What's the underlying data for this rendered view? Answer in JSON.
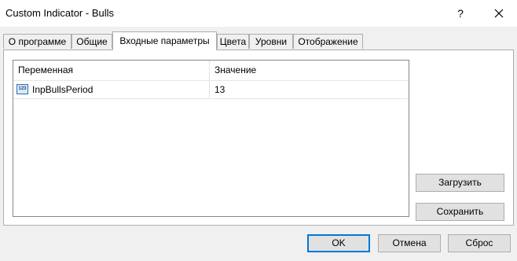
{
  "window": {
    "title": "Custom Indicator - Bulls",
    "help_label": "?",
    "close_label": "×"
  },
  "tabs": [
    {
      "label": "О программе"
    },
    {
      "label": "Общие"
    },
    {
      "label": "Входные параметры"
    },
    {
      "label": "Цвета"
    },
    {
      "label": "Уровни"
    },
    {
      "label": "Отображение"
    }
  ],
  "active_tab": "Входные параметры",
  "params_table": {
    "headers": [
      "Переменная",
      "Значение"
    ],
    "rows": [
      {
        "icon": "integer-variable-icon",
        "icon_text": "123",
        "name": "InpBullsPeriod",
        "value": "13"
      }
    ]
  },
  "side_buttons": {
    "load_label": "Загрузить",
    "save_label": "Сохранить"
  },
  "footer": {
    "ok_label": "OK",
    "cancel_label": "Отмена",
    "reset_label": "Сброс"
  },
  "colors": {
    "accent": "#0078d7",
    "dialog_bg": "#f0f0f0",
    "panel_bg": "#ffffff"
  }
}
